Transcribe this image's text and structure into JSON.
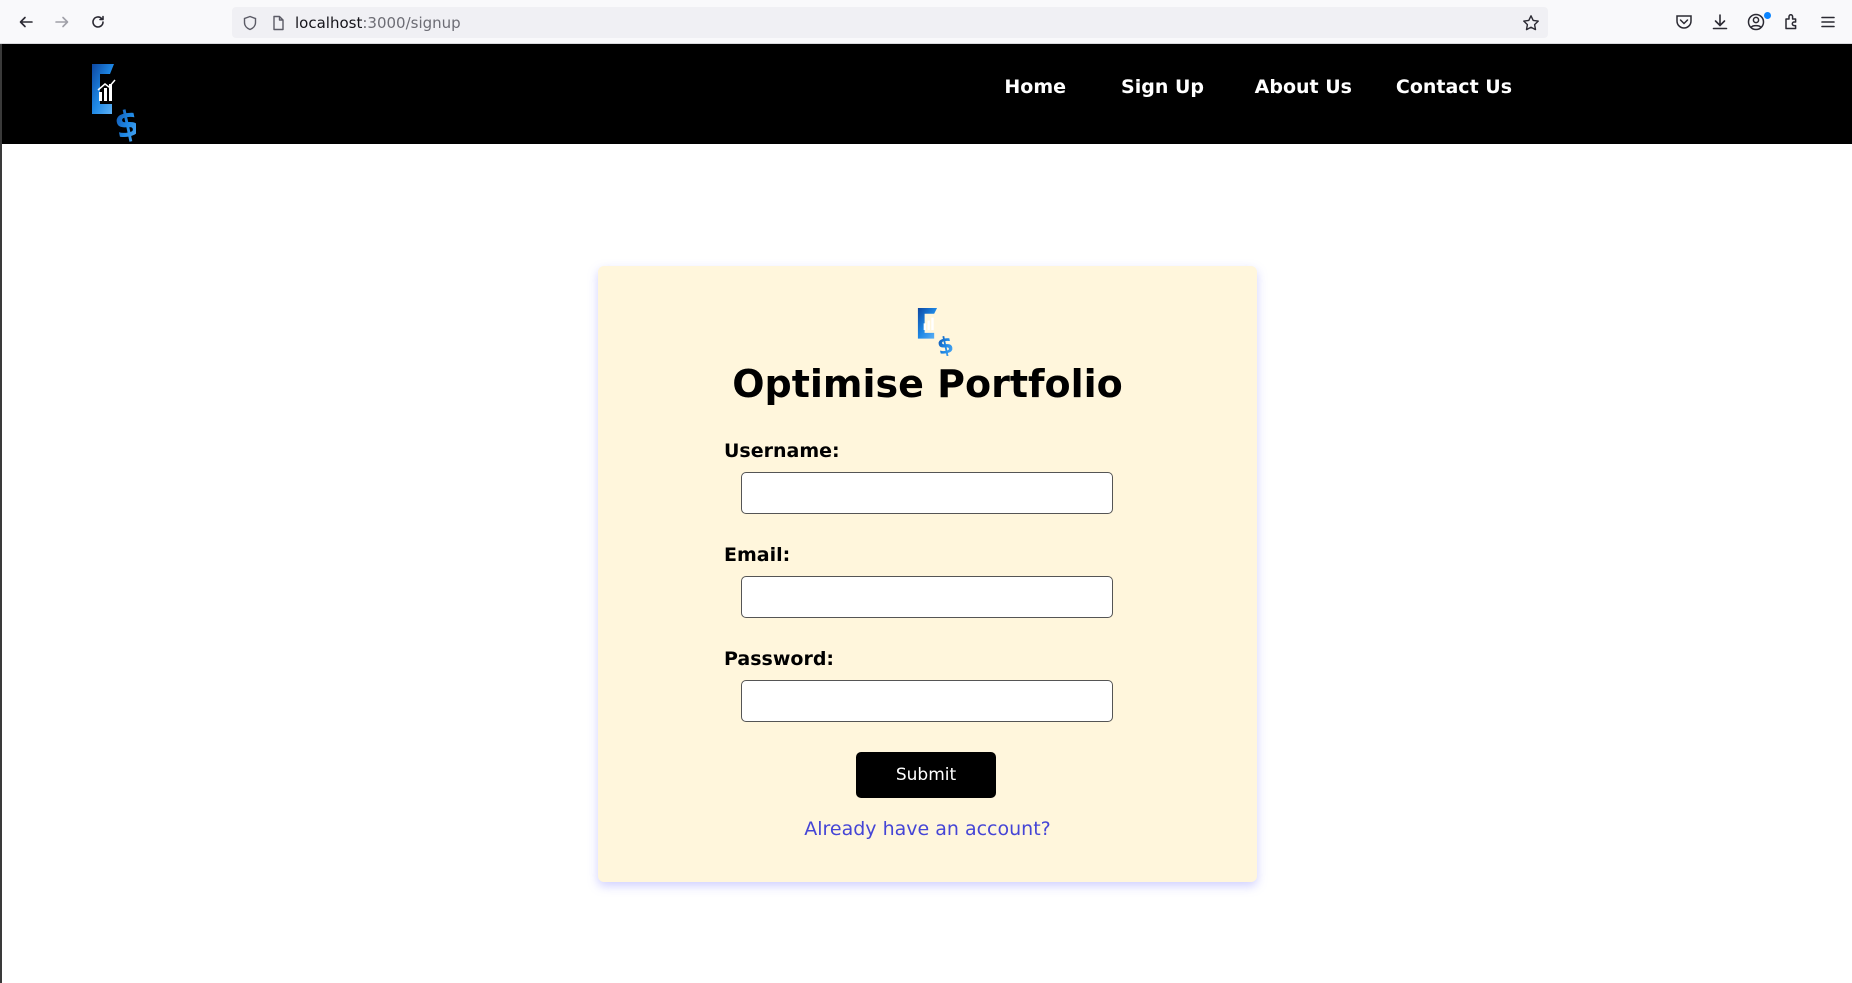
{
  "browser": {
    "url_host": "localhost",
    "url_path": ":3000/signup"
  },
  "header": {
    "nav": [
      {
        "label": "Home"
      },
      {
        "label": "Sign Up"
      },
      {
        "label": "About Us"
      },
      {
        "label": "Contact Us"
      }
    ]
  },
  "form": {
    "title": "Optimise Portfolio",
    "username_label": "Username:",
    "username_value": "",
    "email_label": "Email:",
    "email_value": "",
    "password_label": "Password:",
    "password_value": "",
    "submit_label": "Submit",
    "login_link": "Already have an account?"
  },
  "colors": {
    "header_bg": "#000000",
    "card_bg": "#fff6dc",
    "link": "#4545d6",
    "logo_blue": "#1e88e5"
  }
}
